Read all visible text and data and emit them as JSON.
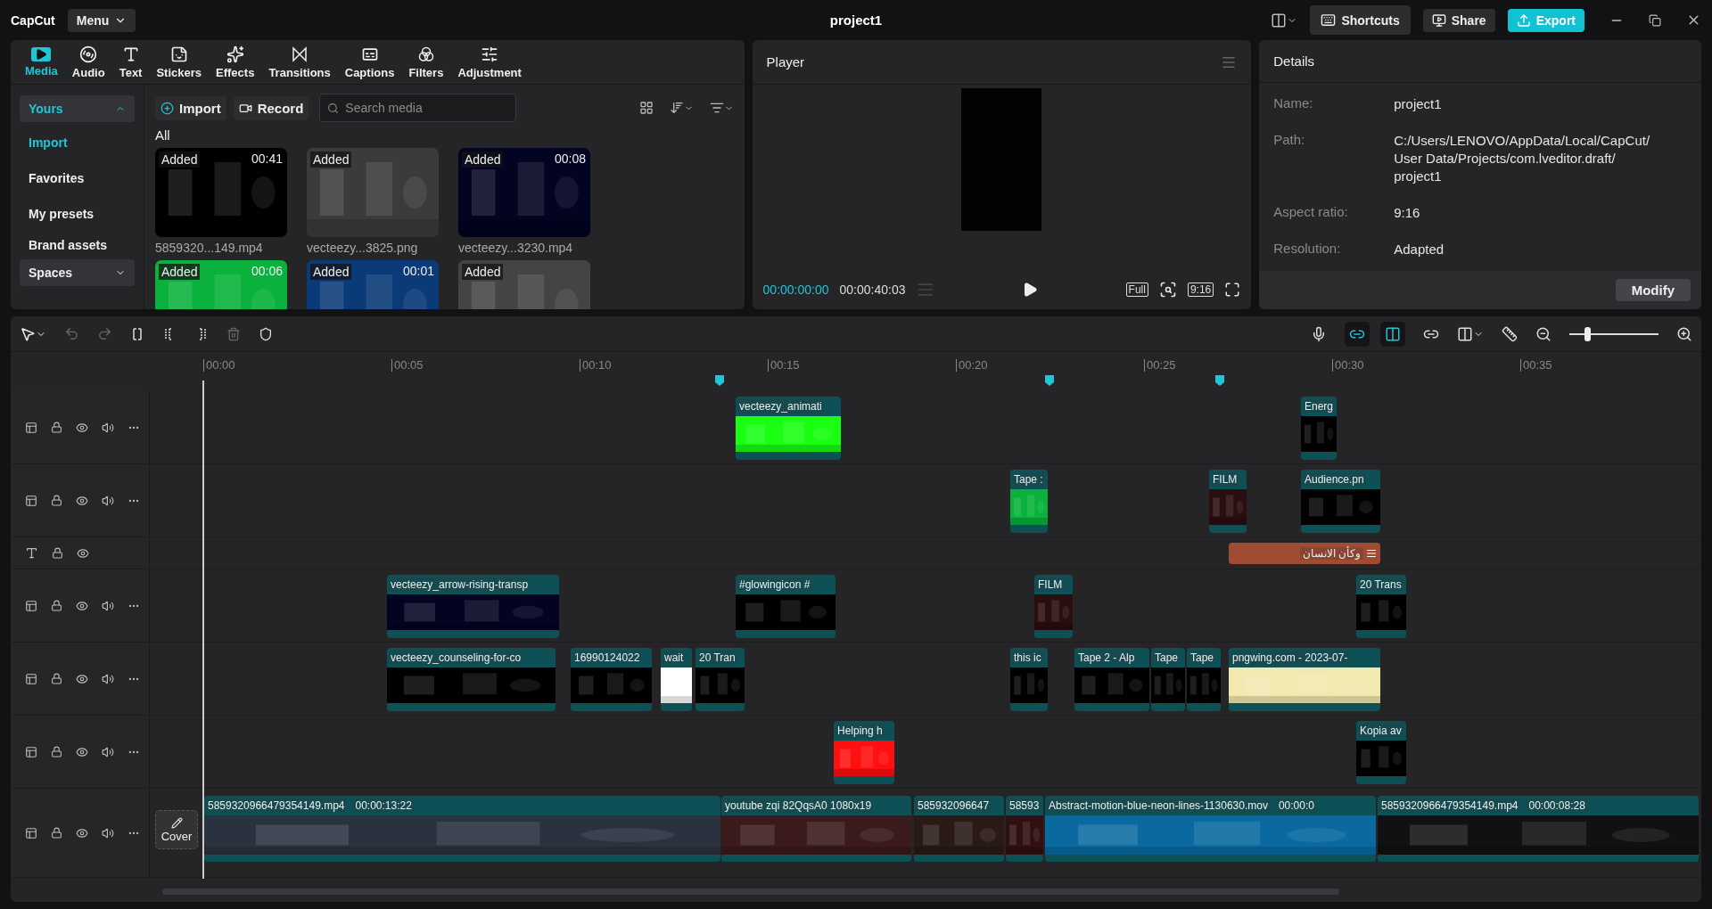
{
  "app": {
    "logo": "CapCut",
    "menu": "Menu",
    "title": "project1"
  },
  "top_actions": {
    "shortcuts": "Shortcuts",
    "share": "Share",
    "export": "Export"
  },
  "tabs": [
    {
      "label": "Media",
      "selected": true
    },
    {
      "label": "Audio",
      "selected": false
    },
    {
      "label": "Text",
      "selected": false
    },
    {
      "label": "Stickers",
      "selected": false
    },
    {
      "label": "Effects",
      "selected": false
    },
    {
      "label": "Transitions",
      "selected": false
    },
    {
      "label": "Captions",
      "selected": false
    },
    {
      "label": "Filters",
      "selected": false
    },
    {
      "label": "Adjustment",
      "selected": false
    }
  ],
  "sidebar": {
    "group": {
      "label": "Yours",
      "expanded": true
    },
    "items": [
      {
        "label": "Import",
        "selected": true
      },
      {
        "label": "Favorites",
        "selected": false
      },
      {
        "label": "My presets",
        "selected": false
      },
      {
        "label": "Brand assets",
        "selected": false
      }
    ],
    "spaces": {
      "label": "Spaces",
      "expanded": false
    }
  },
  "media": {
    "import": "Import",
    "record": "Record",
    "search": {
      "placeholder": "Search media"
    },
    "section": "All",
    "items": [
      {
        "badge": "Added",
        "duration": "00:41",
        "filename": "5859320...149.mp4"
      },
      {
        "badge": "Added",
        "filename": "vecteezy...3825.png"
      },
      {
        "badge": "Added",
        "duration": "00:08",
        "filename": "vecteezy...3230.mp4"
      },
      {
        "badge": "Added",
        "duration": "00:06"
      },
      {
        "badge": "Added",
        "duration": "00:01"
      },
      {
        "badge": "Added"
      }
    ]
  },
  "player": {
    "title": "Player",
    "current": "00:00:00:00",
    "total": "00:00:40:03",
    "full": "Full",
    "ratio": "9:16"
  },
  "details": {
    "title": "Details",
    "rows": [
      {
        "label": "Name:",
        "value": "project1"
      },
      {
        "label": "Path:",
        "value": "C:/Users/LENOVO/AppData/Local/CapCut/\nUser Data/Projects/com.lveditor.draft/\nproject1"
      },
      {
        "label": "Aspect ratio:",
        "value": "9:16"
      },
      {
        "label": "Resolution:",
        "value": "Adapted"
      }
    ],
    "modify": "Modify"
  },
  "timeline": {
    "zoom": {
      "level": 0.2
    },
    "ruler": [
      "00:00",
      "00:05",
      "00:10",
      "00:15",
      "00:20",
      "00:25",
      "00:30",
      "00:35"
    ],
    "tracks": [
      {
        "kind": "video",
        "clips": [
          {
            "label": "vecteezy_animati"
          },
          {
            "label": "Energ"
          }
        ]
      },
      {
        "kind": "video",
        "clips": [
          {
            "label": "Tape :"
          },
          {
            "label": "FILM"
          },
          {
            "label": "Audience.pn"
          }
        ]
      },
      {
        "kind": "text",
        "clips": [
          {
            "label": "وكأن الانسان"
          }
        ]
      },
      {
        "kind": "video",
        "clips": [
          {
            "label": "vecteezy_arrow-rising-transp"
          },
          {
            "label": "#glowingicon #"
          },
          {
            "label": "FILM"
          },
          {
            "label": "20 Trans"
          }
        ]
      },
      {
        "kind": "video",
        "clips": [
          {
            "label": "vecteezy_counseling-for-co"
          },
          {
            "label": "16990124022"
          },
          {
            "label": "wait"
          },
          {
            "label": "20 Tran"
          },
          {
            "label": "this ic"
          },
          {
            "label": "Tape 2 - Alp"
          },
          {
            "label": "Tape"
          },
          {
            "label": "Tape"
          },
          {
            "label": "pngwing.com - 2023-07-"
          }
        ]
      },
      {
        "kind": "video",
        "clips": [
          {
            "label": "Helping h"
          },
          {
            "label": "Kopia av"
          }
        ]
      },
      {
        "kind": "main",
        "cover": "Cover",
        "clips": [
          {
            "label": "5859320966479354149.mp4",
            "duration": "00:00:13:22"
          },
          {
            "label": "youtube zqi 82QqsA0 1080x19"
          },
          {
            "label": "585932096647"
          },
          {
            "label": "58593"
          },
          {
            "label": "Abstract-motion-blue-neon-lines-1130630.mov",
            "duration": "00:00:0"
          },
          {
            "label": "5859320966479354149.mp4",
            "duration": "00:00:08:28"
          }
        ]
      }
    ]
  }
}
